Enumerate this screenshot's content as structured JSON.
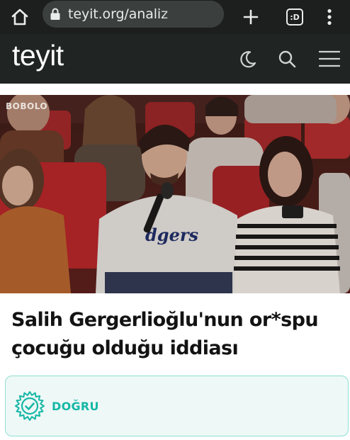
{
  "browser": {
    "url": "teyit.org/analiz",
    "tab_count": ":D",
    "icons": [
      "home-icon",
      "lock-icon",
      "plus-icon",
      "tab-switcher-icon",
      "more-vert-icon"
    ]
  },
  "site": {
    "logo": "teyit",
    "icons": [
      "moon-icon",
      "search-icon",
      "hamburger-menu-icon"
    ]
  },
  "article": {
    "image_watermark": "BOBOLO",
    "title": "Salih Gergerlioğlu'nun or*spu çocuğu olduğu iddiası",
    "verdict": {
      "label": "DOĞRU",
      "icon": "verified-badge-icon",
      "color": "#16b7a6"
    }
  },
  "colors": {
    "chrome": "#1c1f1e",
    "header": "#202524",
    "accent": "#16b7a6"
  }
}
